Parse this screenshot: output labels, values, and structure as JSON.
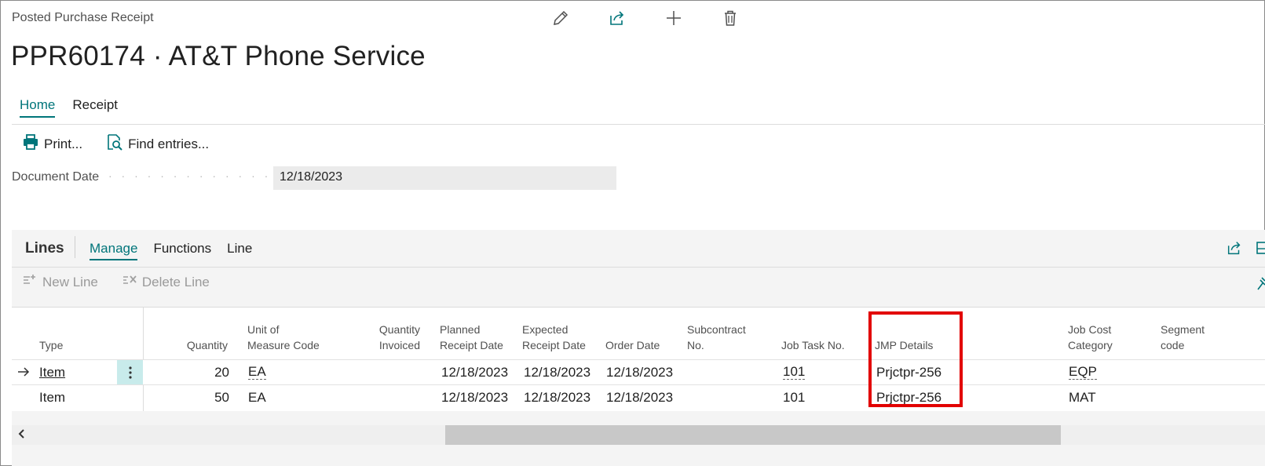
{
  "page": {
    "caption": "Posted Purchase Receipt",
    "title": "PPR60174 · AT&T Phone Service"
  },
  "top_icons": [
    "pencil-icon",
    "share-icon",
    "plus-icon",
    "trash-icon"
  ],
  "tabs": [
    {
      "label": "Home",
      "active": true
    },
    {
      "label": "Receipt",
      "active": false
    }
  ],
  "actions": {
    "print": "Print...",
    "find_entries": "Find entries..."
  },
  "fields": {
    "document_date_label": "Document Date",
    "document_date_dots": "· · · · · · · · · · · · · · · · · · · ·",
    "document_date_value": "12/18/2023"
  },
  "lines": {
    "title": "Lines",
    "tabs": [
      {
        "label": "Manage",
        "active": true
      },
      {
        "label": "Functions",
        "active": false
      },
      {
        "label": "Line",
        "active": false
      }
    ],
    "actions": {
      "new_line": "New Line",
      "delete_line": "Delete Line"
    },
    "columns": {
      "type": "Type",
      "quantity": "Quantity",
      "uom_1": "Unit of",
      "uom_2": "Measure Code",
      "qty_inv_1": "Quantity",
      "qty_inv_2": "Invoiced",
      "planned_1": "Planned",
      "planned_2": "Receipt Date",
      "expected_1": "Expected",
      "expected_2": "Receipt Date",
      "order_date": "Order Date",
      "subcontract_1": "Subcontract",
      "subcontract_2": "No.",
      "job_task": "Job Task No.",
      "jmp_details": "JMP Details",
      "job_cost_1": "Job Cost",
      "job_cost_2": "Category",
      "segment_1": "Segment",
      "segment_2": "code"
    },
    "rows": [
      {
        "type": "Item",
        "quantity": "20",
        "uom": "EA",
        "planned": "12/18/2023",
        "expected": "12/18/2023",
        "order_date": "12/18/2023",
        "job_task": "101",
        "jmp": "Prjctpr-256",
        "job_cost": "EQP"
      },
      {
        "type": "Item",
        "quantity": "50",
        "uom": "EA",
        "planned": "12/18/2023",
        "expected": "12/18/2023",
        "order_date": "12/18/2023",
        "job_task": "101",
        "jmp": "Prjctpr-256",
        "job_cost": "MAT"
      }
    ]
  },
  "colors": {
    "accent": "#00757a",
    "highlight": "#e20000"
  }
}
